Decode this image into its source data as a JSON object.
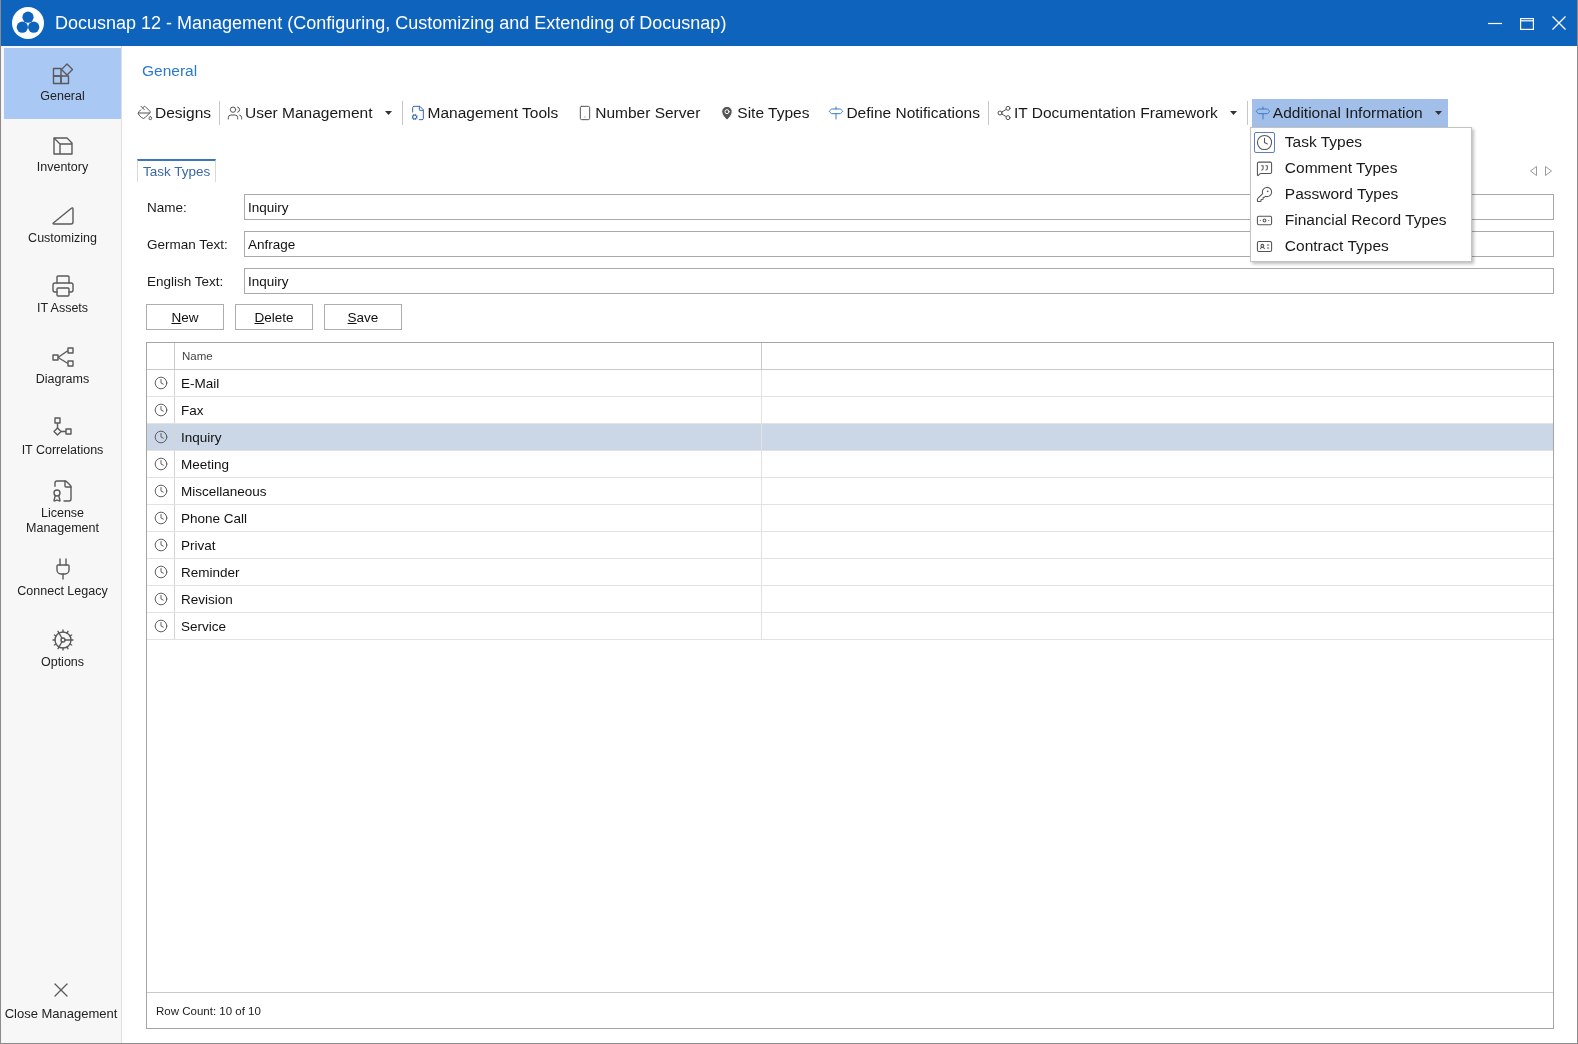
{
  "window": {
    "title": "Docusnap 12 - Management (Configuring, Customizing and Extending of Docusnap)"
  },
  "sidebar": {
    "items": [
      {
        "label": "General",
        "selected": true
      },
      {
        "label": "Inventory",
        "selected": false
      },
      {
        "label": "Customizing",
        "selected": false
      },
      {
        "label": "IT Assets",
        "selected": false
      },
      {
        "label": "Diagrams",
        "selected": false
      },
      {
        "label": "IT Correlations",
        "selected": false
      },
      {
        "label": "License Management",
        "selected": false
      },
      {
        "label": "Connect Legacy",
        "selected": false
      },
      {
        "label": "Options",
        "selected": false
      }
    ],
    "footer_item": {
      "label": "Close Management"
    }
  },
  "section_title": "General",
  "toolbar": {
    "groups": [
      {
        "items": [
          {
            "label": "Designs",
            "dropdown": false,
            "expanded": false
          }
        ]
      },
      {
        "items": [
          {
            "label": "User Management",
            "dropdown": true,
            "expanded": false
          }
        ]
      },
      {
        "items": [
          {
            "label": "Management Tools",
            "dropdown": false,
            "expanded": false
          },
          {
            "label": "Number Server",
            "dropdown": false,
            "expanded": false
          },
          {
            "label": "Site Types",
            "dropdown": false,
            "expanded": false
          },
          {
            "label": "Define Notifications",
            "dropdown": false,
            "expanded": false
          }
        ]
      },
      {
        "items": [
          {
            "label": "IT Documentation Framework",
            "dropdown": true,
            "expanded": false
          }
        ]
      },
      {
        "items": [
          {
            "label": "Additional Information",
            "dropdown": true,
            "expanded": true,
            "menu_items": [
              {
                "label": "Task Types",
                "selected": true
              },
              {
                "label": "Comment Types",
                "selected": false
              },
              {
                "label": "Password Types",
                "selected": false
              },
              {
                "label": "Financial Record Types",
                "selected": false
              },
              {
                "label": "Contract Types",
                "selected": false
              }
            ]
          }
        ]
      }
    ]
  },
  "tabs": [
    {
      "label": "Task Types",
      "selected": true
    }
  ],
  "form": {
    "fields": [
      {
        "label": "Name:",
        "value": "Inquiry"
      },
      {
        "label": "German Text:",
        "value": "Anfrage"
      },
      {
        "label": "English Text:",
        "value": "Inquiry"
      }
    ],
    "buttons": [
      "New",
      "Delete",
      "Save"
    ]
  },
  "table": {
    "columns": [
      {
        "label": "Name"
      }
    ],
    "rows": [
      {
        "name": "E-Mail",
        "selected": false
      },
      {
        "name": "Fax",
        "selected": false
      },
      {
        "name": "Inquiry",
        "selected": true
      },
      {
        "name": "Meeting",
        "selected": false
      },
      {
        "name": "Miscellaneous",
        "selected": false
      },
      {
        "name": "Phone Call",
        "selected": false
      },
      {
        "name": "Privat",
        "selected": false
      },
      {
        "name": "Reminder",
        "selected": false
      },
      {
        "name": "Revision",
        "selected": false
      },
      {
        "name": "Service",
        "selected": false
      }
    ],
    "footer": "Row Count: 10 of 10"
  }
}
